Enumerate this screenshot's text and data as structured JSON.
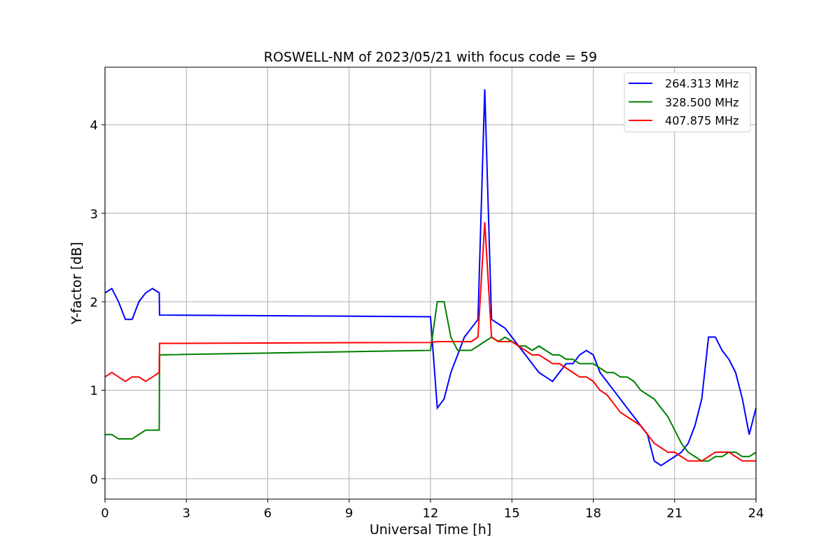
{
  "chart_data": {
    "type": "line",
    "title": "ROSWELL-NM of 2023/05/21 with focus code = 59",
    "xlabel": "Universal Time [h]",
    "ylabel": "Y-factor [dB]",
    "x": [
      0,
      0.25,
      0.5,
      0.75,
      1,
      1.25,
      1.5,
      1.75,
      2,
      2.01,
      12,
      12.25,
      12.5,
      12.75,
      13,
      13.25,
      13.5,
      13.75,
      14,
      14.25,
      14.5,
      14.75,
      15,
      15.25,
      15.5,
      15.75,
      16,
      16.25,
      16.5,
      16.75,
      17,
      17.25,
      17.5,
      17.75,
      18,
      18.25,
      18.5,
      18.75,
      19,
      19.25,
      19.5,
      19.75,
      20,
      20.25,
      20.5,
      20.75,
      21,
      21.25,
      21.5,
      21.75,
      22,
      22.25,
      22.5,
      22.75,
      23,
      23.25,
      23.5,
      23.75,
      24
    ],
    "series": [
      {
        "name": "264.313 MHz",
        "color": "#0000ff",
        "values": [
          2.1,
          2.15,
          2.0,
          1.8,
          1.8,
          2.0,
          2.1,
          2.15,
          2.1,
          1.85,
          1.83,
          0.8,
          0.9,
          1.2,
          1.4,
          1.6,
          1.7,
          1.8,
          4.4,
          1.8,
          1.75,
          1.7,
          1.6,
          1.5,
          1.4,
          1.3,
          1.2,
          1.15,
          1.1,
          1.2,
          1.3,
          1.3,
          1.4,
          1.45,
          1.4,
          1.2,
          1.1,
          1.0,
          0.9,
          0.8,
          0.7,
          0.6,
          0.5,
          0.2,
          0.15,
          0.2,
          0.25,
          0.3,
          0.4,
          0.6,
          0.9,
          1.6,
          1.6,
          1.45,
          1.35,
          1.2,
          0.9,
          0.5,
          0.8
        ]
      },
      {
        "name": "328.500 MHz",
        "color": "#008000",
        "values": [
          0.5,
          0.5,
          0.45,
          0.45,
          0.45,
          0.5,
          0.55,
          0.55,
          0.55,
          1.4,
          1.45,
          2.0,
          2.0,
          1.6,
          1.45,
          1.45,
          1.45,
          1.5,
          1.55,
          1.6,
          1.55,
          1.6,
          1.55,
          1.5,
          1.5,
          1.45,
          1.5,
          1.45,
          1.4,
          1.4,
          1.35,
          1.35,
          1.3,
          1.3,
          1.3,
          1.25,
          1.2,
          1.2,
          1.15,
          1.15,
          1.1,
          1.0,
          0.95,
          0.9,
          0.8,
          0.7,
          0.55,
          0.4,
          0.3,
          0.25,
          0.2,
          0.2,
          0.25,
          0.25,
          0.3,
          0.3,
          0.25,
          0.25,
          0.3
        ]
      },
      {
        "name": "407.875 MHz",
        "color": "#ff0000",
        "values": [
          1.15,
          1.2,
          1.15,
          1.1,
          1.15,
          1.15,
          1.1,
          1.15,
          1.2,
          1.53,
          1.54,
          1.55,
          1.55,
          1.55,
          1.55,
          1.55,
          1.55,
          1.6,
          2.9,
          1.6,
          1.55,
          1.55,
          1.55,
          1.5,
          1.45,
          1.4,
          1.4,
          1.35,
          1.3,
          1.3,
          1.25,
          1.2,
          1.15,
          1.15,
          1.1,
          1.0,
          0.95,
          0.85,
          0.75,
          0.7,
          0.65,
          0.6,
          0.5,
          0.4,
          0.35,
          0.3,
          0.3,
          0.25,
          0.2,
          0.2,
          0.2,
          0.25,
          0.3,
          0.3,
          0.3,
          0.25,
          0.2,
          0.2,
          0.2
        ]
      }
    ],
    "grid": true,
    "legend": "upper right",
    "xlim": [
      0,
      24
    ],
    "ylim": [
      -0.23,
      4.65
    ],
    "xticks": [
      0,
      3,
      6,
      9,
      12,
      15,
      18,
      21,
      24
    ],
    "yticks": [
      0,
      1,
      2,
      3,
      4
    ]
  }
}
